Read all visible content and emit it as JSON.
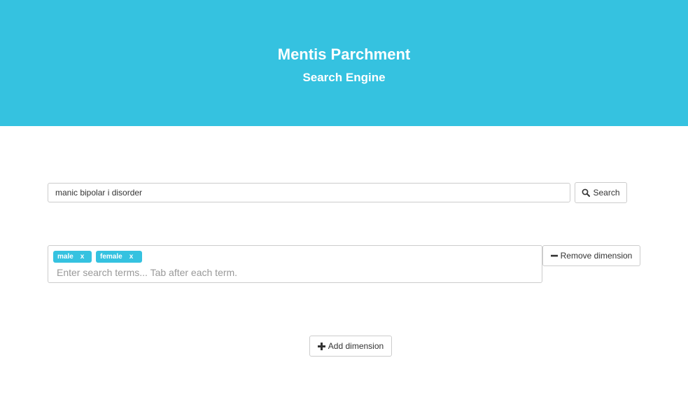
{
  "header": {
    "title": "Mentis Parchment",
    "subtitle": "Search Engine",
    "background_color": "#35c2e0"
  },
  "search": {
    "value": "manic bipolar i disorder",
    "button_label": "Search",
    "button_icon": "search-icon"
  },
  "dimension": {
    "tags": [
      {
        "label": "male",
        "remove": "x"
      },
      {
        "label": "female",
        "remove": "x"
      }
    ],
    "placeholder": "Enter search terms... Tab after each term.",
    "remove_label": "Remove dimension",
    "remove_icon": "minus-icon",
    "tag_color": "#35c2e0"
  },
  "add_dimension": {
    "label": "Add dimension",
    "icon": "plus-icon"
  }
}
